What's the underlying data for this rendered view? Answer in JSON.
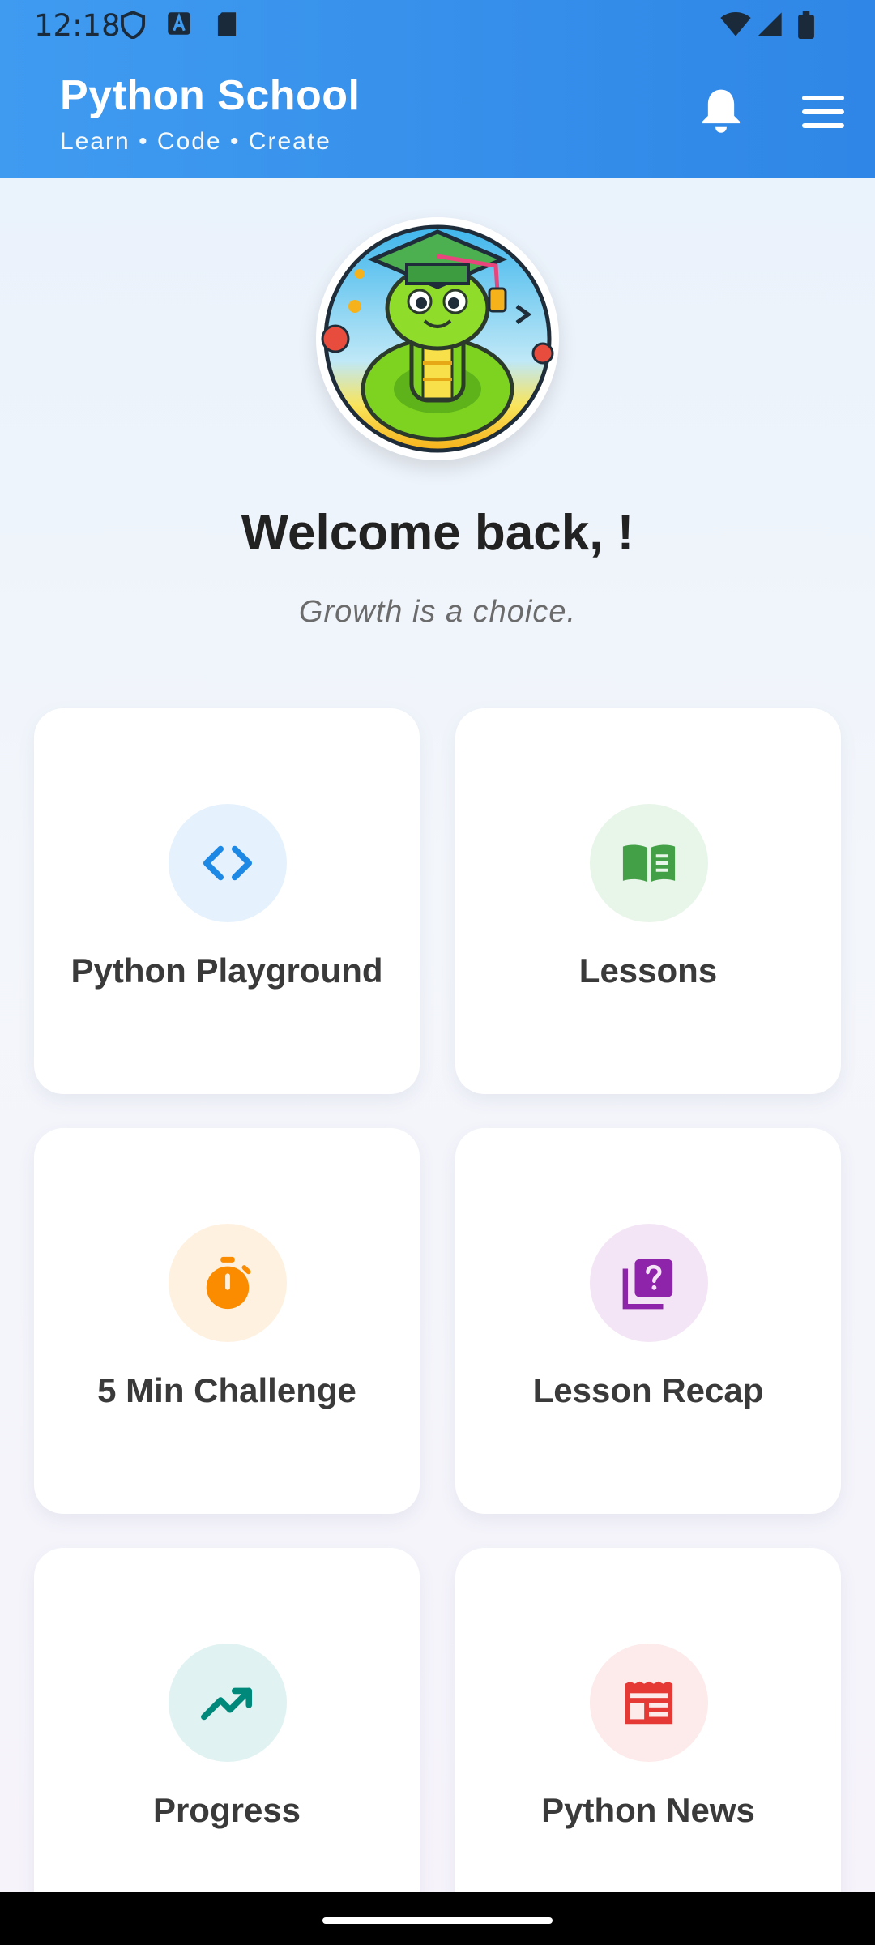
{
  "status_bar": {
    "time": "12:18"
  },
  "app_bar": {
    "title": "Python School",
    "subtitle": "Learn • Code • Create",
    "icons": [
      "bell-icon",
      "menu-icon"
    ],
    "color": "#3a92ee"
  },
  "hero": {
    "avatar": "python-graduate-mascot",
    "welcome": "Welcome back, !",
    "tagline": "Growth is a choice."
  },
  "cards": [
    {
      "label": "Python Playground",
      "icon": "code-icon",
      "color": "#1e88e5",
      "bg": "#e5f1fc"
    },
    {
      "label": "Lessons",
      "icon": "book-icon",
      "color": "#43a047",
      "bg": "#e8f5e9"
    },
    {
      "label": "5 Min Challenge",
      "icon": "timer-icon",
      "color": "#fb8c00",
      "bg": "#fff1e0"
    },
    {
      "label": "Lesson Recap",
      "icon": "quiz-icon",
      "color": "#8e24aa",
      "bg": "#f3e5f5"
    },
    {
      "label": "Progress",
      "icon": "trending-up-icon",
      "color": "#00897b",
      "bg": "#e0f2f1"
    },
    {
      "label": "Python News",
      "icon": "news-icon",
      "color": "#e53935",
      "bg": "#fdeaea"
    }
  ]
}
